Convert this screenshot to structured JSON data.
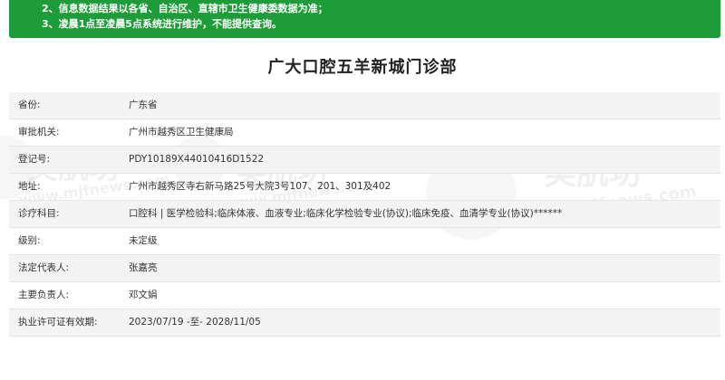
{
  "notice": {
    "lines": [
      "2、信息数据结果以各省、自治区、直辖市卫生健康委数据为准；",
      "3、凌晨1点至凌晨5点系统进行维护，不能提供查询。"
    ]
  },
  "title": "广大口腔五羊新城门诊部",
  "watermark": {
    "text": "美肌坊",
    "subtext": "www.mjfnews.com"
  },
  "rows": [
    {
      "label": "省份:",
      "value": "广东省"
    },
    {
      "label": "审批机关:",
      "value": "广州市越秀区卫生健康局"
    },
    {
      "label": "登记号:",
      "value": "PDY10189X44010416D1522"
    },
    {
      "label": "地址:",
      "value": "广州市越秀区寺右新马路25号大院3号107、201、301及402"
    },
    {
      "label": "诊疗科目:",
      "value": "口腔科 | 医学检验科;临床体液、血液专业;临床化学检验专业(协议);临床免疫、血清学专业(协议)******"
    },
    {
      "label": "级别:",
      "value": "未定级"
    },
    {
      "label": "法定代表人:",
      "value": "张嘉亮"
    },
    {
      "label": "主要负责人:",
      "value": "邓文娟"
    },
    {
      "label": "执业许可证有效期:",
      "value": "2023/07/19 -至- 2028/11/05"
    }
  ],
  "colors": {
    "notice_bg": "#1f9c3a",
    "shade_row": "#f4f4f4"
  }
}
